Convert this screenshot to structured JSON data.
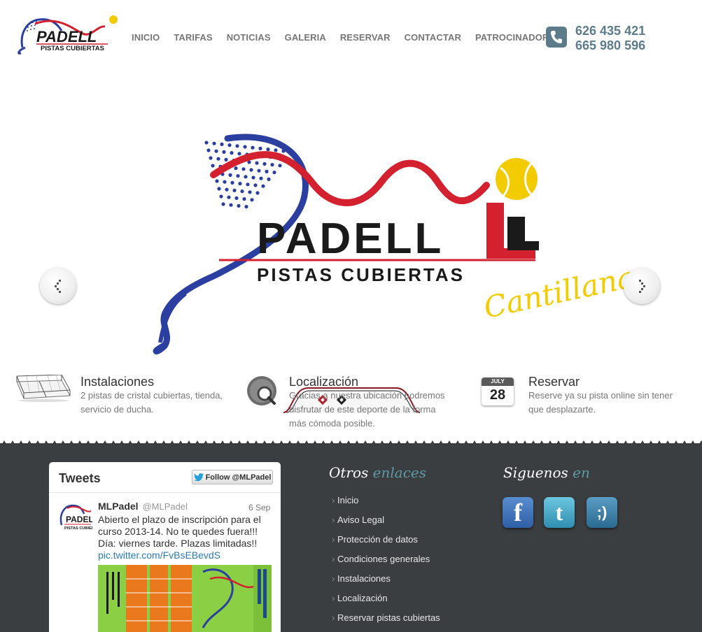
{
  "header": {
    "logo_text": "PADELL",
    "logo_sub": "PISTAS CUBIERTAS",
    "nav": [
      "INICIO",
      "TARIFAS",
      "NOTICIAS",
      "GALERIA",
      "RESERVAR",
      "CONTACTAR",
      "PATROCINADORES"
    ],
    "phones": [
      "626 435 421",
      "665 980 596"
    ],
    "phone_icon": "phone-icon"
  },
  "slider": {
    "logo_text": "PADELL",
    "logo_sub": "PISTAS CUBIERTAS",
    "location": "Cantillana",
    "slide_count": 2,
    "active_slide": 1
  },
  "features": [
    {
      "icon": "court-icon",
      "title": "Instalaciones",
      "desc_lines": [
        "2 pistas de cristal cubiertas, tienda,",
        "servicio de ducha."
      ]
    },
    {
      "icon": "map-search-icon",
      "title": "Localización",
      "desc_lines": [
        "Gracias a nuestra ubicación podremos",
        "disfrutar de este deporte de la forma",
        "más cómoda posible."
      ]
    },
    {
      "icon": "calendar-icon",
      "title": "Reservar",
      "calendar_month": "JULY",
      "calendar_day": "28",
      "desc_lines": [
        "Reserve ya su pista online sin tener",
        "que desplazarte."
      ]
    }
  ],
  "tweets": {
    "title": "Tweets",
    "follow_label": "Follow @MLPadel",
    "tweet": {
      "name": "MLPadel",
      "handle": "@MLPadel",
      "date": "6 Sep",
      "text": "Abierto el plazo de inscripción para el curso 2013-14. No te quedes fuera!!! Día: viernes tarde. Plazas limitadas!!",
      "link": "pic.twitter.com/FvBsEBevdS"
    }
  },
  "otros_enlaces": {
    "title_w1": "Otros",
    "title_w2": "enlaces",
    "links": [
      "Inicio",
      "Aviso Legal",
      "Protección de datos",
      "Condiciones generales",
      "Instalaciones",
      "Localización",
      "Reservar pistas cubiertas"
    ]
  },
  "siguenos": {
    "title_w1": "Siguenos",
    "title_w2": "en",
    "networks": [
      {
        "name": "facebook-icon",
        "glyph": "f",
        "color": "#3b6fb6"
      },
      {
        "name": "twitter-icon",
        "glyph": "t",
        "color": "#3fa9c6"
      },
      {
        "name": "tuenti-icon",
        "glyph": ";)",
        "color": "#3d7fa6"
      }
    ]
  },
  "colors": {
    "accent": "#5c7b8b",
    "footer_bg": "#3b3e41",
    "link_teal": "#5e9aa6",
    "brand_red": "#d32130",
    "brand_blue": "#2a3fa0",
    "brand_yellow": "#f2cc00"
  }
}
